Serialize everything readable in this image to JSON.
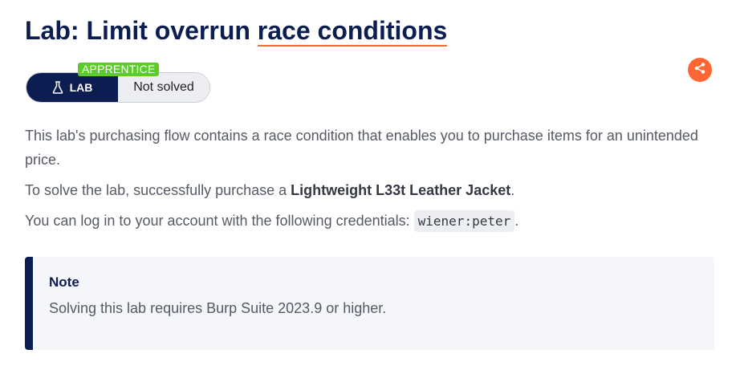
{
  "title": {
    "prefix": "Lab: Limit overrun ",
    "link": "race conditions"
  },
  "badge": {
    "level": "APPRENTICE",
    "lab_label": "LAB",
    "status": "Not solved",
    "lab_icon": "flask-icon"
  },
  "share": {
    "icon": "share-icon"
  },
  "description": {
    "p1": "This lab's purchasing flow contains a race condition that enables you to purchase items for an unintended price.",
    "p2_prefix": "To solve the lab, successfully purchase a ",
    "p2_bold": "Lightweight L33t Leather Jacket",
    "p2_suffix": ".",
    "p3_prefix": "You can log in to your account with the following credentials: ",
    "p3_code": "wiener:peter",
    "p3_suffix": "."
  },
  "note": {
    "title": "Note",
    "text": "Solving this lab requires Burp Suite 2023.9 or higher."
  },
  "colors": {
    "navy": "#0b1d51",
    "accent": "#ff6633",
    "level_green": "#5ccc2a",
    "note_bg": "#f5f6fa"
  }
}
